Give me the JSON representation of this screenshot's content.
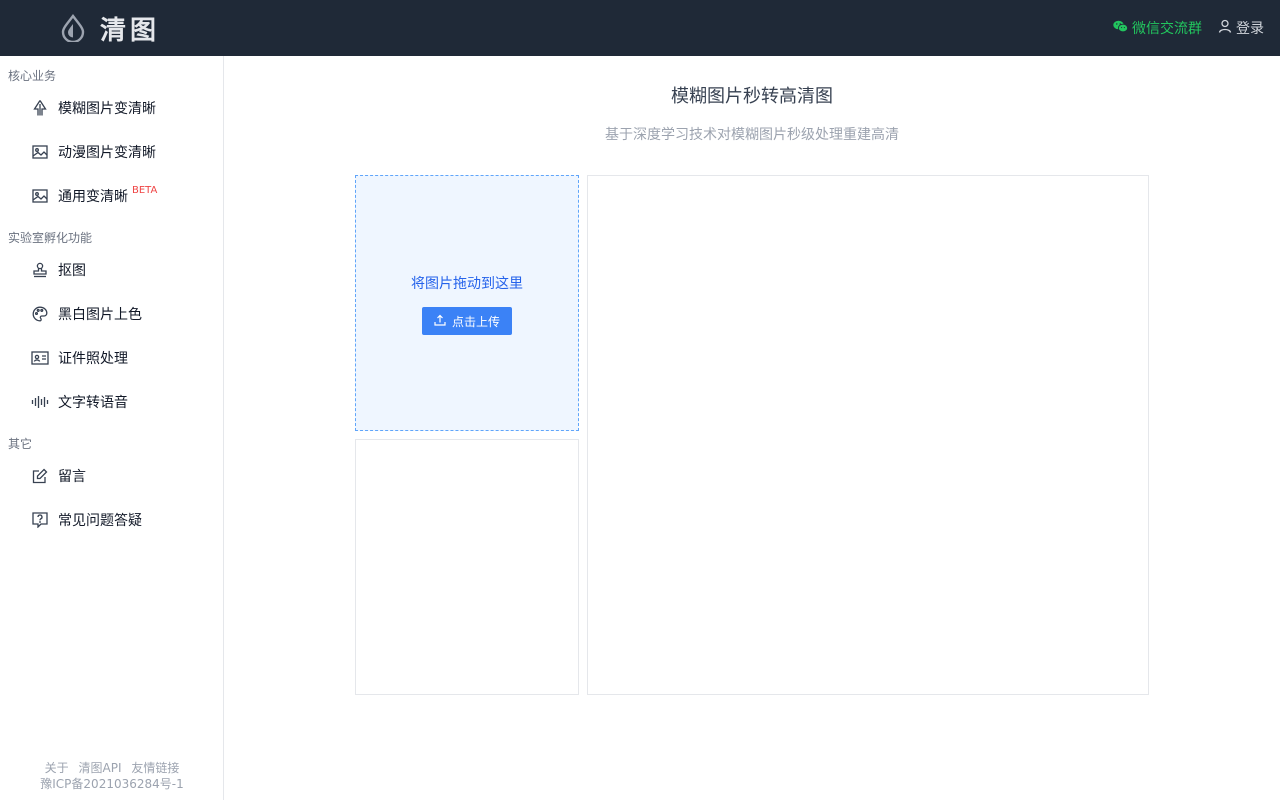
{
  "header": {
    "logo_text": "清图",
    "wechat_label": "微信交流群",
    "login_label": "登录",
    "colors": {
      "background": "#1f2937",
      "wechat": "#22c55e"
    }
  },
  "sidebar": {
    "sections": [
      {
        "title": "核心业务",
        "items": [
          {
            "label": "模糊图片变清晰",
            "icon": "tree-icon"
          },
          {
            "label": "动漫图片变清晰",
            "icon": "image-icon"
          },
          {
            "label": "通用变清晰",
            "icon": "image-icon",
            "badge": "BETA"
          }
        ]
      },
      {
        "title": "实验室孵化功能",
        "items": [
          {
            "label": "抠图",
            "icon": "stamp-icon"
          },
          {
            "label": "黑白图片上色",
            "icon": "palette-icon"
          },
          {
            "label": "证件照处理",
            "icon": "id-card-icon"
          },
          {
            "label": "文字转语音",
            "icon": "waveform-icon"
          }
        ]
      },
      {
        "title": "其它",
        "items": [
          {
            "label": "留言",
            "icon": "edit-icon"
          },
          {
            "label": "常见问题答疑",
            "icon": "question-icon"
          }
        ]
      }
    ],
    "footer": {
      "links": [
        "关于",
        "清图API",
        "友情链接"
      ],
      "icp": "豫ICP备2021036284号-1"
    }
  },
  "main": {
    "title": "模糊图片秒转高清图",
    "subtitle": "基于深度学习技术对模糊图片秒级处理重建高清",
    "upload": {
      "drop_text": "将图片拖动到这里",
      "button_label": "点击上传"
    },
    "colors": {
      "accent": "#3b82f6",
      "drop_bg": "#eff6ff"
    }
  }
}
